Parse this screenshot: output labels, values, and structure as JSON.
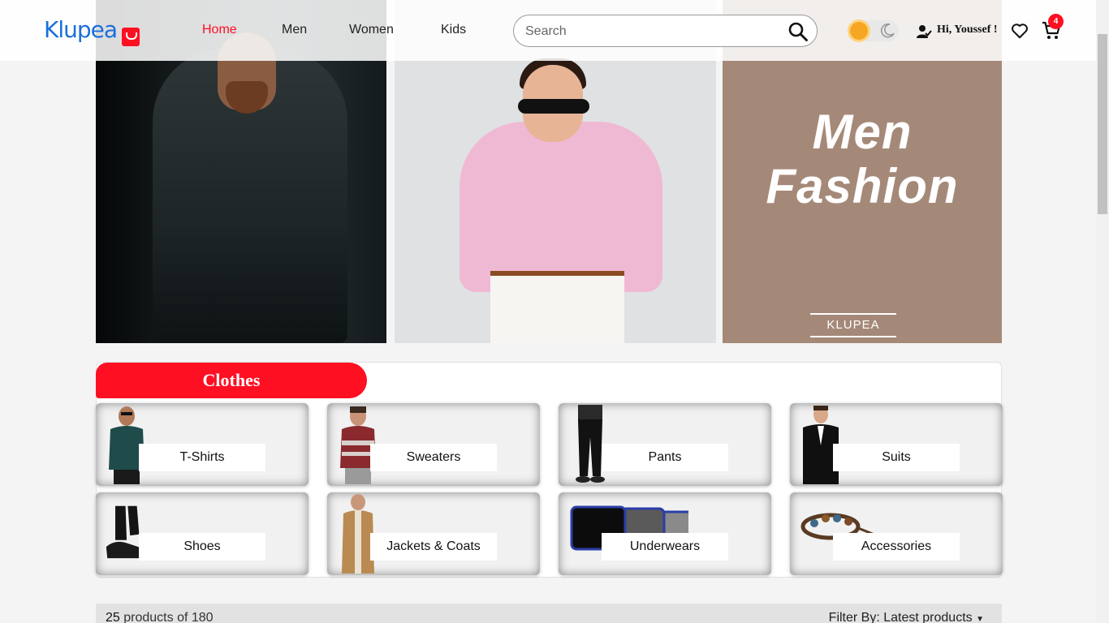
{
  "header": {
    "logo": "Klupea",
    "nav": [
      {
        "label": "Home",
        "active": true
      },
      {
        "label": "Men",
        "active": false
      },
      {
        "label": "Women",
        "active": false
      },
      {
        "label": "Kids",
        "active": false
      }
    ],
    "search_placeholder": "Search",
    "greeting": "Hi, Youssef !",
    "cart_count": "4",
    "accent_color": "#ff0f22",
    "brand_color": "#1a6fdc"
  },
  "hero": {
    "headline_1": "Men",
    "headline_2": "Fashion",
    "brand_mark": "KLUPEA"
  },
  "categories": {
    "title": "Clothes",
    "items": [
      {
        "label": "T-Shirts",
        "thumb_icon": "tshirt-model-icon"
      },
      {
        "label": "Sweaters",
        "thumb_icon": "sweater-model-icon"
      },
      {
        "label": "Pants",
        "thumb_icon": "pants-model-icon"
      },
      {
        "label": "Suits",
        "thumb_icon": "suit-model-icon"
      },
      {
        "label": "Shoes",
        "thumb_icon": "shoes-icon"
      },
      {
        "label": "Jackets & Coats",
        "thumb_icon": "coat-model-icon"
      },
      {
        "label": "Underwears",
        "thumb_icon": "underwear-icon"
      },
      {
        "label": "Accessories",
        "thumb_icon": "bracelet-icon"
      }
    ]
  },
  "products": {
    "shown": "25",
    "count_text": "products of 180",
    "filter_label": "Filter By: Latest products"
  }
}
